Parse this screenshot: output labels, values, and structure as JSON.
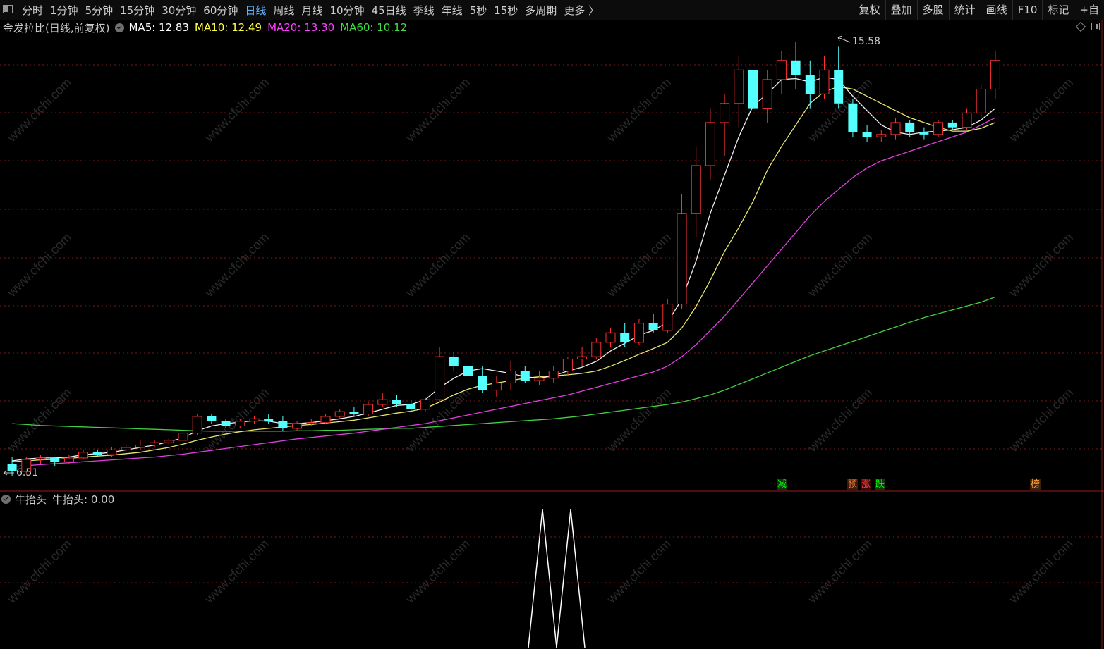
{
  "toolbar": {
    "periods": [
      "分时",
      "1分钟",
      "5分钟",
      "15分钟",
      "30分钟",
      "60分钟",
      "日线",
      "周线",
      "月线",
      "10分钟",
      "45日线",
      "季线",
      "年线",
      "5秒",
      "15秒",
      "多周期",
      "更多 〉"
    ],
    "active_index": 6,
    "tools": [
      "复权",
      "叠加",
      "多股",
      "统计",
      "画线",
      "F10",
      "标记",
      "+自"
    ]
  },
  "info_bar": {
    "stock_title": "金发拉比(日线,前复权)",
    "ma": [
      {
        "text": "MA5: 12.83",
        "color": "#ffffff"
      },
      {
        "text": "MA10: 12.49",
        "color": "#ffff40"
      },
      {
        "text": "MA20: 13.30",
        "color": "#ff40ff"
      },
      {
        "text": "MA60: 10.12",
        "color": "#40e040"
      }
    ]
  },
  "price_labels": {
    "high": "15.58",
    "low": "6.51"
  },
  "signals": [
    {
      "text": "减",
      "color": "#00ff00",
      "bg": "#123312"
    },
    {
      "text": "预",
      "color": "#ff8040",
      "bg": "#3a1a08"
    },
    {
      "text": "涨",
      "color": "#ff4040",
      "bg": "#3a0808"
    },
    {
      "text": "跌",
      "color": "#00ff00",
      "bg": "#123312"
    },
    {
      "text": "榜",
      "color": "#ffa040",
      "bg": "#3a2208"
    }
  ],
  "indicator": {
    "name": "牛抬头",
    "value_text": "牛抬头: 0.00",
    "peaks": [
      1,
      1
    ]
  },
  "watermark": "www.cfchi.com",
  "colors": {
    "up": "#ff3232",
    "down": "#54ffff",
    "ma5": "#f0f0f0",
    "ma10": "#e8e870",
    "ma20": "#e040e0",
    "ma60": "#40d040",
    "grid": "#7a1a1a"
  },
  "chart_data": {
    "type": "candlestick",
    "price_high": 15.58,
    "price_low": 6.51,
    "ohlc": [
      [
        6.75,
        6.9,
        6.51,
        6.6
      ],
      [
        6.6,
        6.9,
        6.55,
        6.85
      ],
      [
        6.85,
        6.95,
        6.75,
        6.88
      ],
      [
        6.88,
        6.9,
        6.7,
        6.8
      ],
      [
        6.8,
        6.95,
        6.75,
        6.88
      ],
      [
        6.88,
        7.05,
        6.85,
        7.0
      ],
      [
        7.0,
        7.05,
        6.9,
        6.95
      ],
      [
        6.95,
        7.1,
        6.9,
        7.05
      ],
      [
        7.05,
        7.15,
        7.0,
        7.1
      ],
      [
        7.1,
        7.25,
        7.05,
        7.15
      ],
      [
        7.15,
        7.25,
        7.1,
        7.2
      ],
      [
        7.2,
        7.3,
        7.15,
        7.25
      ],
      [
        7.25,
        7.45,
        7.2,
        7.4
      ],
      [
        7.4,
        7.8,
        7.35,
        7.75
      ],
      [
        7.75,
        7.8,
        7.6,
        7.65
      ],
      [
        7.65,
        7.7,
        7.5,
        7.55
      ],
      [
        7.55,
        7.7,
        7.5,
        7.65
      ],
      [
        7.65,
        7.75,
        7.6,
        7.7
      ],
      [
        7.7,
        7.8,
        7.6,
        7.65
      ],
      [
        7.65,
        7.75,
        7.45,
        7.5
      ],
      [
        7.5,
        7.65,
        7.45,
        7.6
      ],
      [
        7.6,
        7.7,
        7.55,
        7.62
      ],
      [
        7.62,
        7.8,
        7.6,
        7.75
      ],
      [
        7.75,
        7.9,
        7.7,
        7.85
      ],
      [
        7.85,
        7.95,
        7.75,
        7.8
      ],
      [
        7.8,
        8.05,
        7.75,
        8.0
      ],
      [
        8.0,
        8.25,
        7.95,
        8.1
      ],
      [
        8.1,
        8.2,
        7.95,
        8.0
      ],
      [
        8.0,
        8.1,
        7.85,
        7.9
      ],
      [
        7.9,
        8.15,
        7.85,
        8.1
      ],
      [
        8.1,
        9.2,
        8.05,
        9.0
      ],
      [
        9.0,
        9.1,
        8.7,
        8.8
      ],
      [
        8.8,
        9.0,
        8.5,
        8.6
      ],
      [
        8.6,
        8.8,
        8.25,
        8.3
      ],
      [
        8.3,
        8.6,
        8.15,
        8.45
      ],
      [
        8.45,
        8.9,
        8.3,
        8.7
      ],
      [
        8.7,
        8.8,
        8.45,
        8.5
      ],
      [
        8.5,
        8.7,
        8.4,
        8.55
      ],
      [
        8.55,
        8.8,
        8.45,
        8.7
      ],
      [
        8.7,
        9.0,
        8.6,
        8.95
      ],
      [
        8.95,
        9.2,
        8.8,
        9.0
      ],
      [
        9.0,
        9.4,
        8.95,
        9.3
      ],
      [
        9.3,
        9.6,
        9.2,
        9.5
      ],
      [
        9.5,
        9.7,
        9.2,
        9.3
      ],
      [
        9.3,
        9.8,
        9.25,
        9.7
      ],
      [
        9.7,
        9.9,
        9.5,
        9.55
      ],
      [
        9.55,
        10.2,
        9.5,
        10.1
      ],
      [
        10.1,
        12.4,
        10.0,
        12.0
      ],
      [
        12.0,
        13.4,
        11.5,
        13.0
      ],
      [
        13.0,
        14.2,
        12.7,
        13.9
      ],
      [
        13.9,
        14.5,
        13.2,
        14.3
      ],
      [
        14.3,
        15.3,
        13.8,
        15.0
      ],
      [
        15.0,
        15.1,
        14.0,
        14.2
      ],
      [
        14.2,
        15.0,
        13.9,
        14.8
      ],
      [
        14.8,
        15.4,
        14.5,
        15.2
      ],
      [
        15.2,
        15.58,
        14.6,
        14.9
      ],
      [
        14.9,
        15.2,
        14.2,
        14.5
      ],
      [
        14.5,
        15.3,
        14.4,
        15.0
      ],
      [
        15.0,
        15.5,
        14.2,
        14.3
      ],
      [
        14.3,
        14.4,
        13.6,
        13.7
      ],
      [
        13.7,
        13.85,
        13.5,
        13.6
      ],
      [
        13.6,
        13.75,
        13.5,
        13.65
      ],
      [
        13.65,
        14.0,
        13.55,
        13.9
      ],
      [
        13.9,
        13.95,
        13.6,
        13.7
      ],
      [
        13.7,
        13.8,
        13.55,
        13.65
      ],
      [
        13.65,
        13.95,
        13.6,
        13.9
      ],
      [
        13.9,
        13.95,
        13.75,
        13.8
      ],
      [
        13.8,
        14.2,
        13.75,
        14.1
      ],
      [
        14.1,
        14.7,
        14.0,
        14.6
      ],
      [
        14.6,
        15.4,
        14.4,
        15.2
      ]
    ],
    "ma5": [
      6.82,
      6.86,
      6.88,
      6.88,
      6.9,
      6.95,
      6.97,
      7.0,
      7.05,
      7.1,
      7.15,
      7.22,
      7.3,
      7.45,
      7.55,
      7.6,
      7.63,
      7.66,
      7.65,
      7.6,
      7.6,
      7.62,
      7.66,
      7.7,
      7.75,
      7.82,
      7.9,
      7.98,
      8.0,
      8.1,
      8.35,
      8.55,
      8.7,
      8.75,
      8.7,
      8.65,
      8.58,
      8.55,
      8.6,
      8.7,
      8.78,
      8.9,
      9.12,
      9.28,
      9.45,
      9.55,
      9.72,
      10.2,
      11.0,
      12.0,
      12.8,
      13.6,
      14.25,
      14.5,
      14.8,
      14.82,
      14.75,
      14.85,
      14.8,
      14.45,
      14.15,
      13.85,
      13.7,
      13.65,
      13.7,
      13.72,
      13.75,
      13.8,
      13.95,
      14.2
    ],
    "ma10": [
      6.8,
      6.82,
      6.84,
      6.85,
      6.87,
      6.9,
      6.92,
      6.94,
      6.97,
      7.0,
      7.05,
      7.1,
      7.17,
      7.25,
      7.32,
      7.38,
      7.43,
      7.47,
      7.5,
      7.53,
      7.56,
      7.58,
      7.61,
      7.64,
      7.67,
      7.72,
      7.77,
      7.82,
      7.86,
      7.92,
      8.05,
      8.2,
      8.32,
      8.4,
      8.45,
      8.5,
      8.55,
      8.58,
      8.6,
      8.62,
      8.65,
      8.7,
      8.8,
      8.92,
      9.05,
      9.17,
      9.3,
      9.6,
      10.05,
      10.6,
      11.2,
      11.7,
      12.25,
      12.9,
      13.4,
      13.85,
      14.3,
      14.55,
      14.65,
      14.6,
      14.45,
      14.3,
      14.15,
      14.0,
      13.9,
      13.8,
      13.72,
      13.72,
      13.78,
      13.9
    ],
    "ma20": [
      6.7,
      6.72,
      6.74,
      6.76,
      6.78,
      6.8,
      6.82,
      6.84,
      6.86,
      6.88,
      6.9,
      6.93,
      6.96,
      7.0,
      7.04,
      7.08,
      7.12,
      7.16,
      7.2,
      7.24,
      7.28,
      7.31,
      7.34,
      7.37,
      7.4,
      7.44,
      7.48,
      7.52,
      7.56,
      7.6,
      7.66,
      7.72,
      7.78,
      7.84,
      7.9,
      7.96,
      8.02,
      8.08,
      8.14,
      8.2,
      8.28,
      8.36,
      8.44,
      8.52,
      8.6,
      8.68,
      8.8,
      9.0,
      9.25,
      9.55,
      9.85,
      10.2,
      10.55,
      10.9,
      11.25,
      11.6,
      11.95,
      12.25,
      12.5,
      12.75,
      12.95,
      13.1,
      13.2,
      13.3,
      13.4,
      13.5,
      13.6,
      13.7,
      13.85,
      14.0
    ],
    "ma60": [
      7.6,
      7.58,
      7.56,
      7.55,
      7.54,
      7.53,
      7.52,
      7.51,
      7.5,
      7.49,
      7.48,
      7.47,
      7.46,
      7.45,
      7.44,
      7.44,
      7.44,
      7.44,
      7.44,
      7.44,
      7.45,
      7.45,
      7.46,
      7.46,
      7.47,
      7.48,
      7.49,
      7.5,
      7.5,
      7.52,
      7.54,
      7.56,
      7.58,
      7.6,
      7.62,
      7.64,
      7.66,
      7.68,
      7.7,
      7.73,
      7.76,
      7.8,
      7.84,
      7.88,
      7.92,
      7.96,
      8.0,
      8.05,
      8.12,
      8.2,
      8.3,
      8.42,
      8.54,
      8.66,
      8.78,
      8.9,
      9.02,
      9.12,
      9.22,
      9.32,
      9.42,
      9.52,
      9.62,
      9.72,
      9.82,
      9.9,
      9.98,
      10.06,
      10.14,
      10.25
    ]
  }
}
